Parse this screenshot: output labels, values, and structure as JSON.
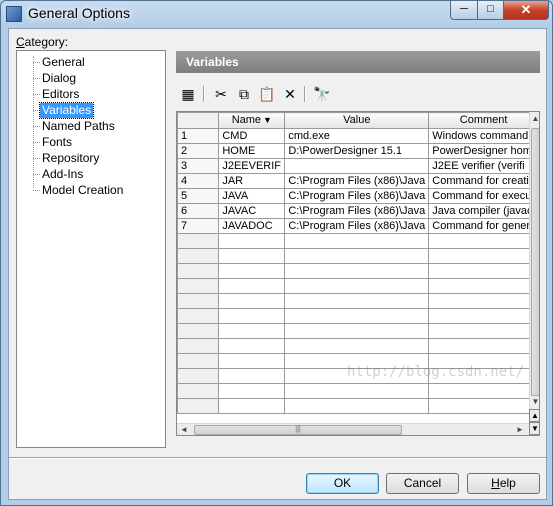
{
  "window": {
    "title": "General Options",
    "controls": {
      "minimize": "─",
      "maximize": "□",
      "close": "✕"
    }
  },
  "category": {
    "label_underlined": "C",
    "label_rest": "ategory:",
    "items": [
      {
        "label": "General"
      },
      {
        "label": "Dialog"
      },
      {
        "label": "Editors"
      },
      {
        "label": "Variables",
        "selected": true
      },
      {
        "label": "Named Paths"
      },
      {
        "label": "Fonts"
      },
      {
        "label": "Repository"
      },
      {
        "label": "Add-Ins"
      },
      {
        "label": "Model Creation"
      }
    ]
  },
  "panel": {
    "title": "Variables"
  },
  "toolbar": {
    "icons": [
      "properties-icon",
      "cut-icon",
      "copy-icon",
      "paste-icon",
      "delete-icon",
      "find-icon"
    ],
    "glyphs": [
      "▦",
      "✂",
      "⧉",
      "📋",
      "✕",
      "🔭"
    ]
  },
  "grid": {
    "columns": [
      "Name",
      "Value",
      "Comment"
    ],
    "sort_indicator": "▼",
    "rows": [
      {
        "num": "1",
        "name": "CMD",
        "value": "cmd.exe",
        "comment": "Windows command"
      },
      {
        "num": "2",
        "name": "HOME",
        "value": "D:\\PowerDesigner 15.1",
        "comment": "PowerDesigner hom"
      },
      {
        "num": "3",
        "name": "J2EEVERIF",
        "value": "",
        "comment": "J2EE verifier (verifi"
      },
      {
        "num": "4",
        "name": "JAR",
        "value": "C:\\Program Files (x86)\\Java",
        "comment": "Command for creatin"
      },
      {
        "num": "5",
        "name": "JAVA",
        "value": "C:\\Program Files (x86)\\Java",
        "comment": "Command for execu"
      },
      {
        "num": "6",
        "name": "JAVAC",
        "value": "C:\\Program Files (x86)\\Java",
        "comment": "Java compiler (javac"
      },
      {
        "num": "7",
        "name": "JAVADOC",
        "value": "C:\\Program Files (x86)\\Java",
        "comment": "Command for gener"
      }
    ],
    "empty_rows": 12
  },
  "watermark": "http://blog.csdn.net/",
  "buttons": {
    "ok": "OK",
    "cancel": "Cancel",
    "help_underlined": "H",
    "help_rest": "elp"
  },
  "colors": {
    "selection": "#3399ff",
    "panel_header": "#8a8a8a",
    "default_button": "#bee6fd"
  }
}
